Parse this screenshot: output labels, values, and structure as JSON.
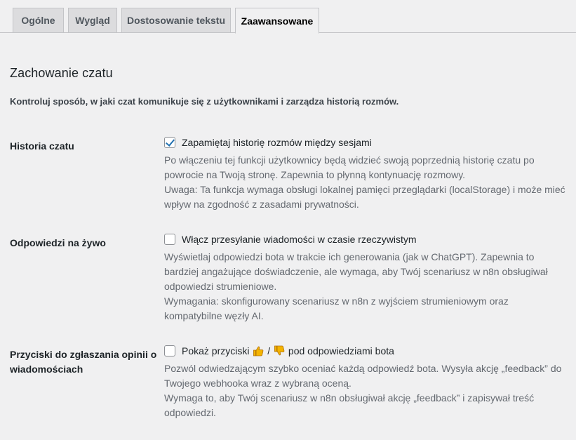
{
  "tabs": [
    {
      "label": "Ogólne",
      "active": false
    },
    {
      "label": "Wygląd",
      "active": false
    },
    {
      "label": "Dostosowanie tekstu",
      "active": false
    },
    {
      "label": "Zaawansowane",
      "active": true
    }
  ],
  "section": {
    "title": "Zachowanie czatu",
    "intro": "Kontroluj sposób, w jaki czat komunikuje się z użytkownikami i zarządza historią rozmów."
  },
  "settings": {
    "history": {
      "label": "Historia czatu",
      "checked": true,
      "checkbox_label": "Zapamiętaj historię rozmów między sesjami",
      "desc_1": "Po włączeniu tej funkcji użytkownicy będą widzieć swoją poprzednią historię czatu po powrocie na Twoją stronę. Zapewnia to płynną kontynuację rozmowy.",
      "desc_2": "Uwaga: Ta funkcja wymaga obsługi lokalnej pamięci przeglądarki (localStorage) i może mieć wpływ na zgodność z zasadami prywatności."
    },
    "streaming": {
      "label": "Odpowiedzi na żywo",
      "checked": false,
      "checkbox_label": "Włącz przesyłanie wiadomości w czasie rzeczywistym",
      "desc_1": "Wyświetlaj odpowiedzi bota w trakcie ich generowania (jak w ChatGPT). Zapewnia to bardziej angażujące doświadczenie, ale wymaga, aby Twój scenariusz w n8n obsługiwał odpowiedzi strumieniowe.",
      "desc_2": "Wymagania: skonfigurowany scenariusz w n8n z wyjściem strumieniowym oraz kompatybilne węzły AI."
    },
    "feedback": {
      "label": "Przyciski do zgłaszania opinii o wiadomościach",
      "checked": false,
      "checkbox_label_before": "Pokaż przyciski",
      "separator": "/",
      "checkbox_label_after": "pod odpowiedziami bota",
      "desc_1": "Pozwól odwiedzającym szybko oceniać każdą odpowiedź bota. Wysyła akcję „feedback” do Twojego webhooka wraz z wybraną oceną.",
      "desc_2": "Wymaga to, aby Twój scenariusz w n8n obsługiwał akcję „feedback” i zapisywał treść odpowiedzi."
    }
  },
  "icons": {
    "thumbs_up": "thumbs-up-icon",
    "thumbs_down": "thumbs-down-icon",
    "check": "checkmark-icon"
  },
  "colors": {
    "accent": "#2271b1",
    "thumb": "#f4b400",
    "thumb_outline": "#b06e00"
  }
}
